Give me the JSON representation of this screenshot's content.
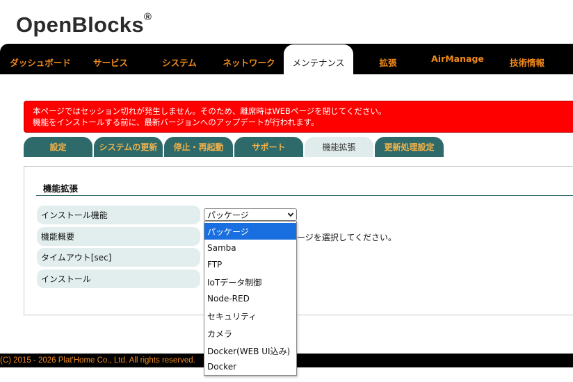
{
  "logo": {
    "text": "OpenBlocks",
    "mark": "®"
  },
  "nav": {
    "items": [
      {
        "label": "ダッシュボード"
      },
      {
        "label": "サービス"
      },
      {
        "label": "システム"
      },
      {
        "label": "ネットワーク"
      },
      {
        "label": "メンテナンス",
        "active": true
      },
      {
        "label": "拡張"
      },
      {
        "label": "AirManage"
      },
      {
        "label": "技術情報"
      }
    ]
  },
  "alert": {
    "line1": "本ページではセッション切れが発生しません。そのため、離席時はWEBページを閉じてください。",
    "line2": "機能をインストールする前に、最新バージョンへのアップデートが行われます。"
  },
  "subtabs": [
    {
      "label": "設定"
    },
    {
      "label": "システムの更新"
    },
    {
      "label": "停止・再起動"
    },
    {
      "label": "サポート"
    },
    {
      "label": "機能拡張",
      "active": true
    },
    {
      "label": "更新処理設定"
    }
  ],
  "section": {
    "title": "機能拡張"
  },
  "form": {
    "labels": {
      "install_feature": "インストール機能",
      "feature_summary": "機能概要",
      "timeout": "タイムアウト[sec]",
      "install": "インストール"
    },
    "select_value": "パッケージ",
    "description_fragment": "ージを選択してください。"
  },
  "dropdown": {
    "options": [
      "パッケージ",
      "Samba",
      "FTP",
      "IoTデータ制御",
      "Node-RED",
      "セキュリティ",
      "カメラ",
      "Docker(WEB UI込み)",
      "Docker"
    ],
    "selected_index": 0
  },
  "footer": {
    "copyright": "(C) 2015 - 2026 Plat'Home Co., Ltd. All rights reserved."
  },
  "colors": {
    "accent_orange": "#f08a1c",
    "alert_red": "#ff0000",
    "tab_teal": "#2e6a6a",
    "select_blue": "#1a6fe0"
  }
}
